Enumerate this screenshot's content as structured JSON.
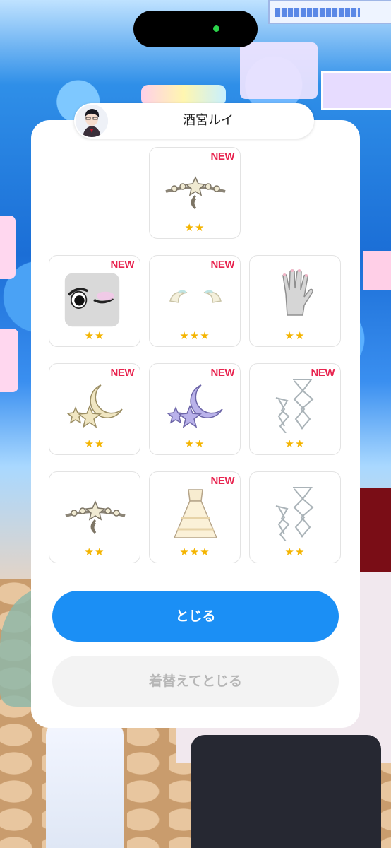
{
  "header": {
    "name": "酒宮ルイ"
  },
  "items": [
    {
      "item": "tiara-moon",
      "new_badge": "NEW",
      "stars": "★★"
    },
    {
      "item": "eye-makeup",
      "new_badge": "NEW",
      "stars": "★★"
    },
    {
      "item": "horns",
      "new_badge": "NEW",
      "stars": "★★★"
    },
    {
      "item": "glove",
      "new_badge": "",
      "stars": "★★"
    },
    {
      "item": "moon-hairpin-gold",
      "new_badge": "NEW",
      "stars": "★★"
    },
    {
      "item": "moon-hairpin-purple",
      "new_badge": "NEW",
      "stars": "★★"
    },
    {
      "item": "ribbon-legwear",
      "new_badge": "NEW",
      "stars": "★★"
    },
    {
      "item": "tiara-moon-2",
      "new_badge": "",
      "stars": "★★"
    },
    {
      "item": "dress",
      "new_badge": "NEW",
      "stars": "★★★"
    },
    {
      "item": "ribbon-legwear-2",
      "new_badge": "",
      "stars": "★★"
    }
  ],
  "buttons": {
    "close_label": "とじる",
    "change_close_label": "着替えてとじる"
  },
  "colors": {
    "primary": "#1b8ff5",
    "new_badge": "#e8244f",
    "star": "#f4b400",
    "disabled_bg": "#f3f3f3",
    "disabled_text": "#b6b6b6"
  }
}
